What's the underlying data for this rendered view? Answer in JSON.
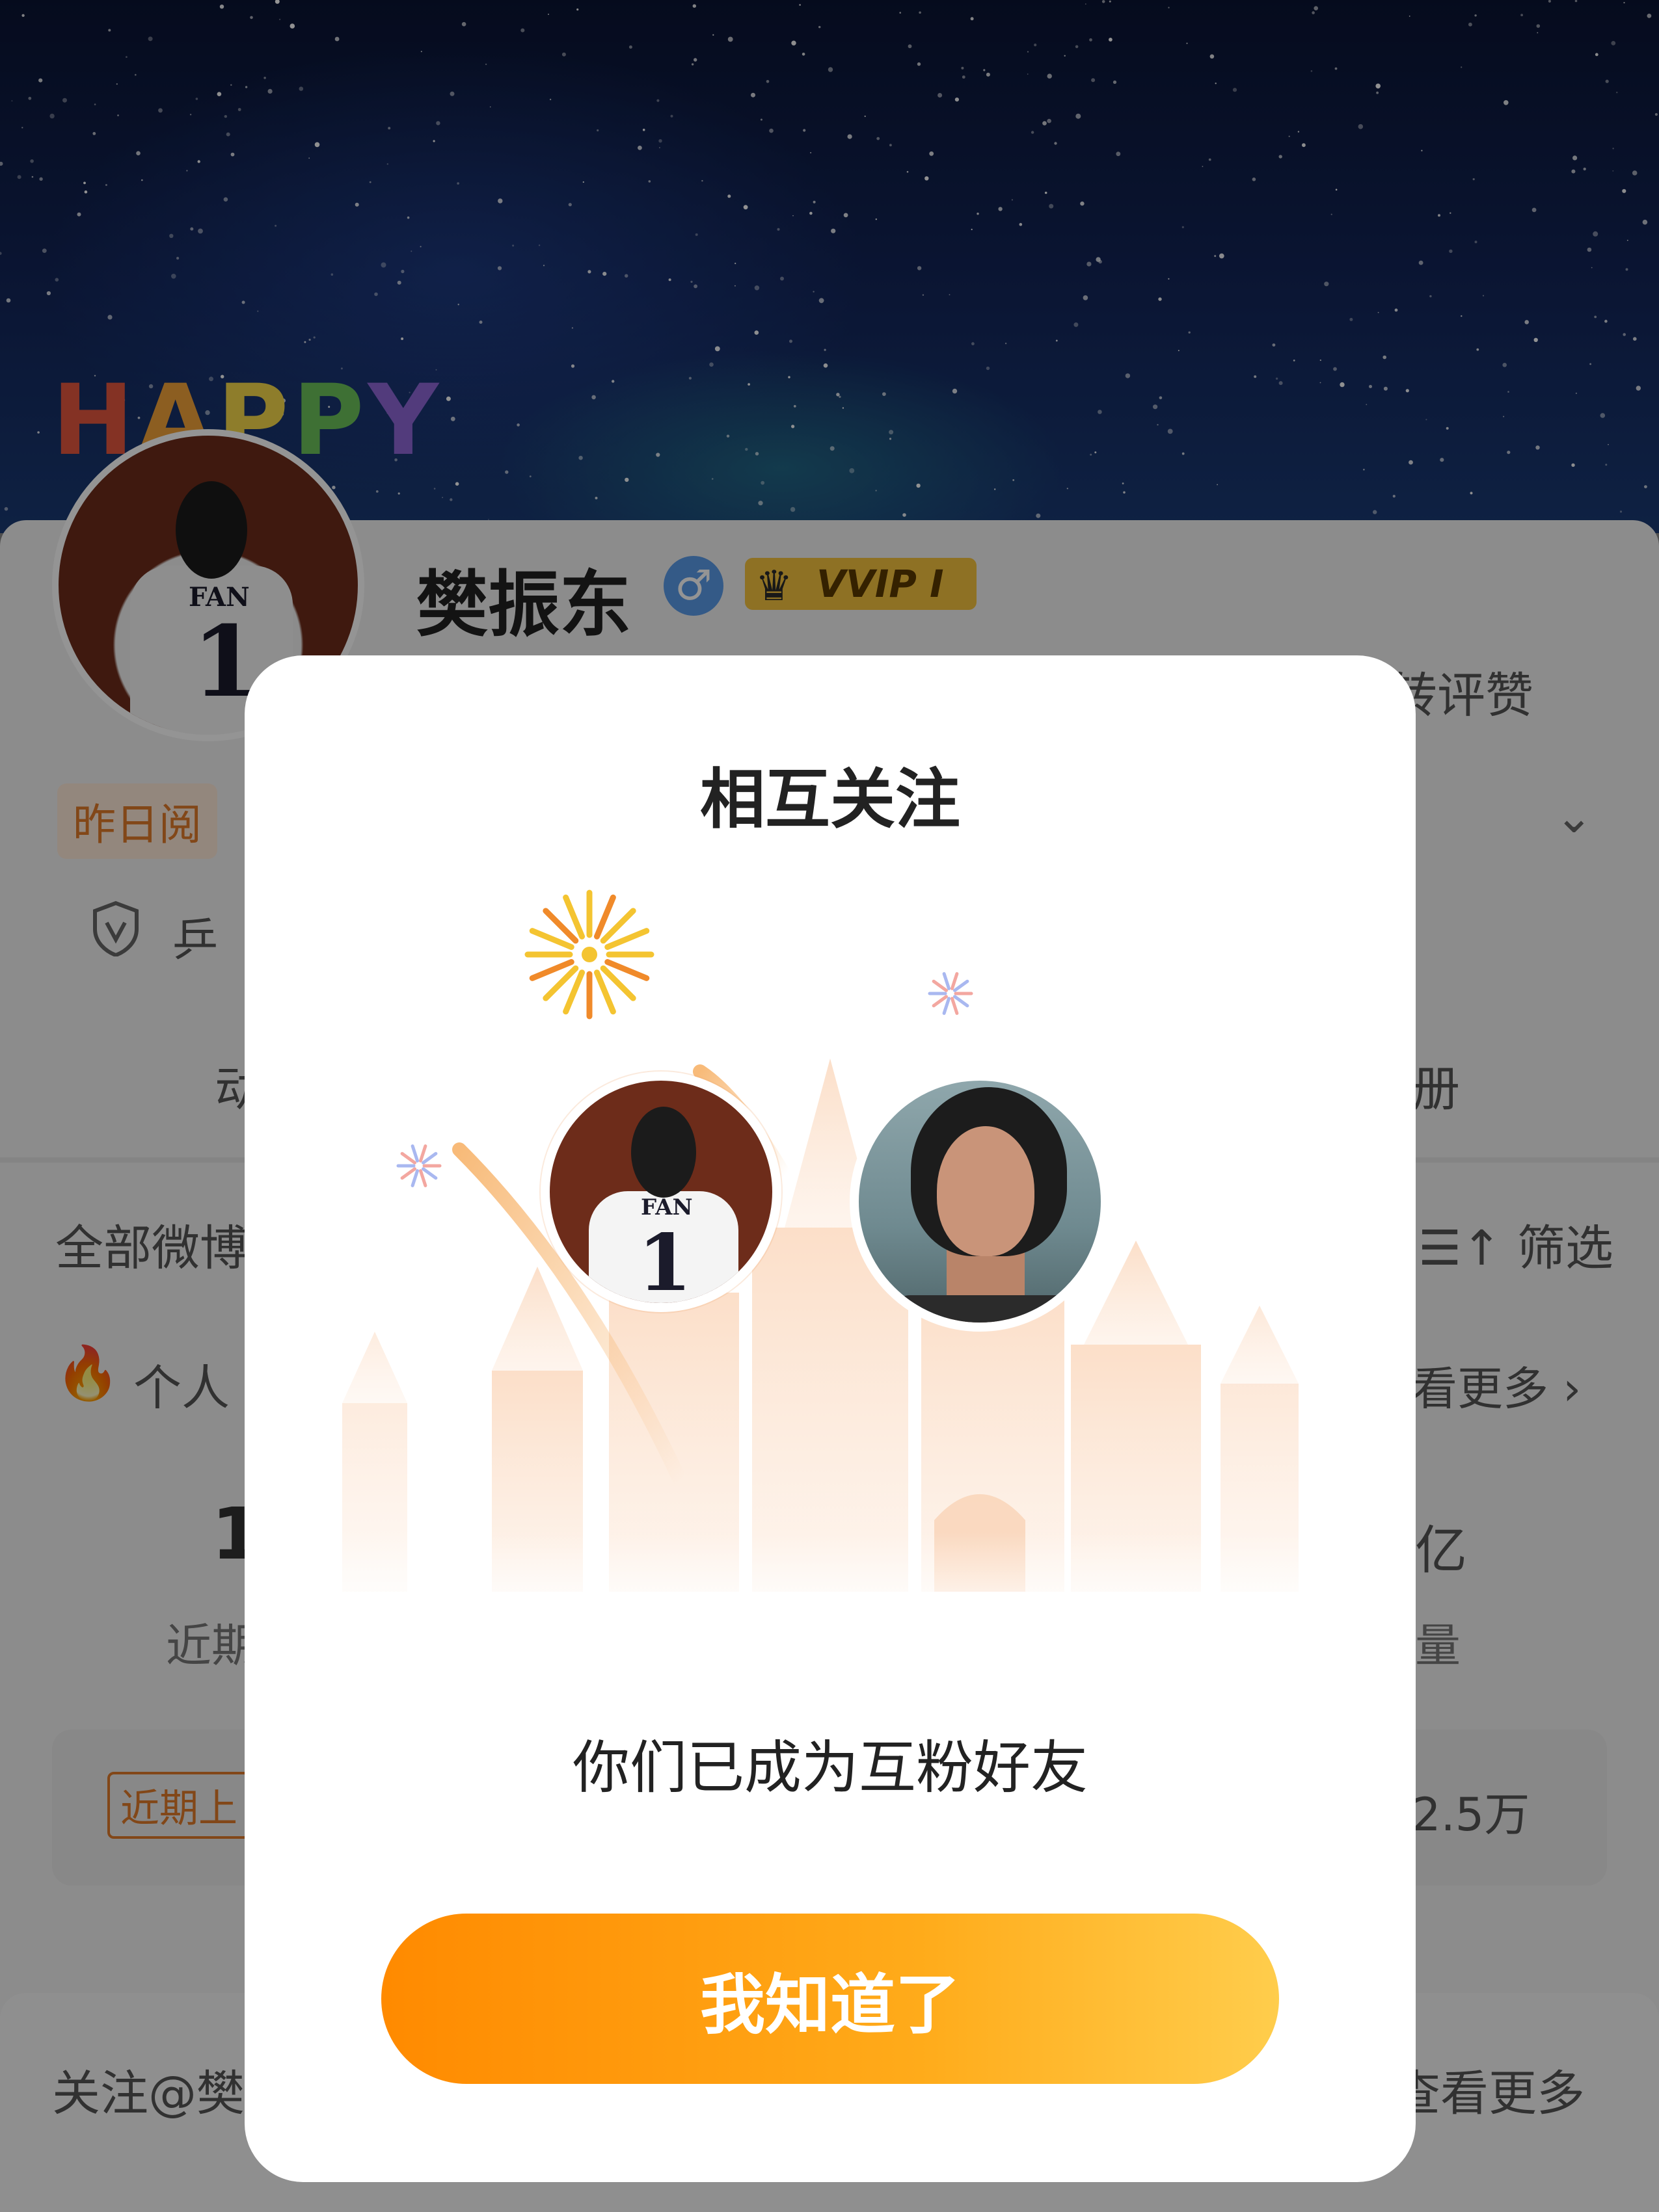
{
  "profile": {
    "banner_text": "HAPPY",
    "name": "樊振东",
    "vip_label": "VVIP I",
    "stats_hint": "转评赞",
    "yesterday_label": "昨日阅",
    "verified_text": "乒",
    "tab_left": "动",
    "tab_right": "册",
    "all_weibo": "全部微博",
    "filter_label": "筛选",
    "personal_label": "个人",
    "see_more": "看更多",
    "stat_value_left": "1",
    "stat_value_right": "亿",
    "stat_label_left": "近期",
    "stat_label_right": "量",
    "recent_badge": "近期上",
    "recent_count": "2.5万",
    "follow_label": "关注@樊",
    "follow_more": "查看更多"
  },
  "modal": {
    "title": "相互关注",
    "message": "你们已成为互粉好友",
    "confirm_button": "我知道了"
  },
  "colors": {
    "accent": "#ff8a00",
    "accent_light": "#ffcd4c",
    "modal_bg": "#ffffff",
    "overlay": "rgba(0,0,0,0.42)"
  },
  "icons": [
    "gender-male-icon",
    "vip-crown-icon",
    "shield-icon",
    "chevron-down-icon",
    "filter-icon",
    "fire-icon",
    "chevron-right-icon",
    "firework-icon",
    "sparkle-icon"
  ]
}
